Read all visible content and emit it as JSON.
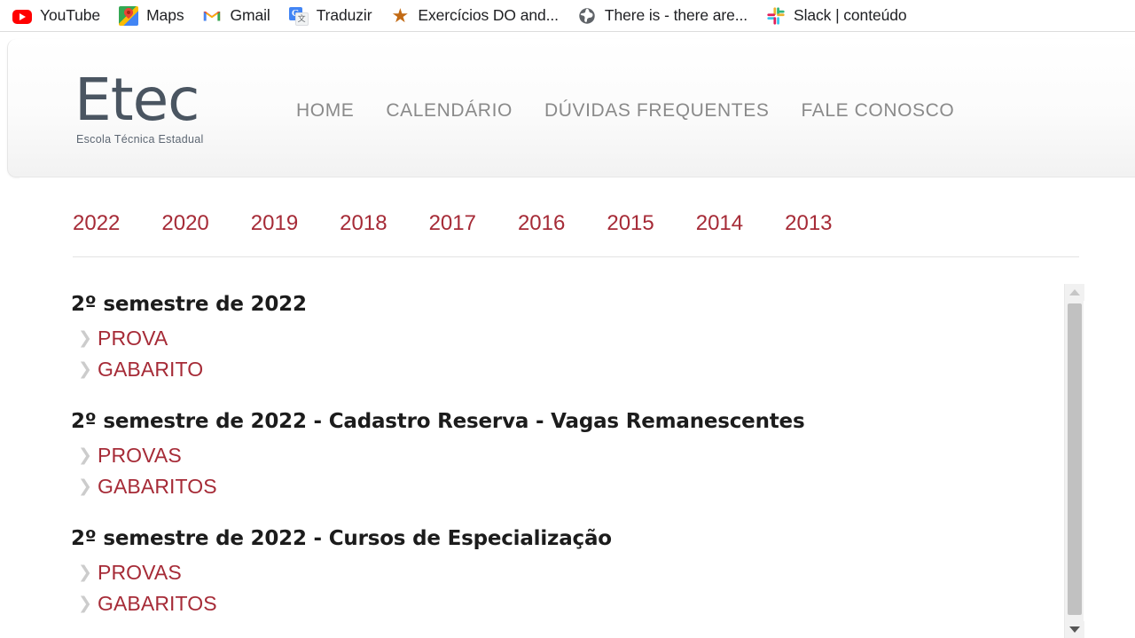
{
  "browser": {
    "bookmarks": [
      {
        "label": "YouTube",
        "icon": "youtube-icon"
      },
      {
        "label": "Maps",
        "icon": "google-maps-icon"
      },
      {
        "label": "Gmail",
        "icon": "gmail-icon"
      },
      {
        "label": "Traduzir",
        "icon": "google-translate-icon"
      },
      {
        "label": "Exercícios DO and...",
        "icon": "star-icon"
      },
      {
        "label": "There is - there are...",
        "icon": "globe-icon"
      },
      {
        "label": "Slack | conteúdo",
        "icon": "slack-icon"
      }
    ]
  },
  "site_header": {
    "logo": {
      "wordmark": "Etec",
      "tagline": "Escola Técnica Estadual"
    },
    "nav": [
      {
        "label": "HOME"
      },
      {
        "label": "CALENDÁRIO"
      },
      {
        "label": "DÚVIDAS FREQUENTES"
      },
      {
        "label": "FALE CONOSCO"
      }
    ]
  },
  "year_tabs": [
    {
      "label": "2022",
      "selected": true
    },
    {
      "label": "2020",
      "selected": false
    },
    {
      "label": "2019",
      "selected": false
    },
    {
      "label": "2018",
      "selected": false
    },
    {
      "label": "2017",
      "selected": false
    },
    {
      "label": "2016",
      "selected": false
    },
    {
      "label": "2015",
      "selected": false
    },
    {
      "label": "2014",
      "selected": false
    },
    {
      "label": "2013",
      "selected": false
    }
  ],
  "content": {
    "sections": [
      {
        "title": "2º semestre de 2022",
        "links": [
          {
            "label": "PROVA"
          },
          {
            "label": "GABARITO"
          }
        ]
      },
      {
        "title": "2º semestre de 2022 - Cadastro Reserva - Vagas Remanescentes",
        "links": [
          {
            "label": "PROVAS"
          },
          {
            "label": "GABARITOS"
          }
        ]
      },
      {
        "title": "2º semestre de 2022 - Cursos de Especialização",
        "links": [
          {
            "label": "PROVAS"
          },
          {
            "label": "GABARITOS"
          }
        ]
      }
    ]
  },
  "scrollbar": {
    "up_arrow": "▲",
    "down_arrow": "▼"
  },
  "glyphs": {
    "chevron": "❯",
    "star": "★",
    "globe": "🌐"
  },
  "colors": {
    "link_red": "#a62b37",
    "logo_slate": "#4a5561",
    "nav_gray": "#8a8a8a",
    "heading_black": "#1c1c1c",
    "chevron_gray": "#cccccc",
    "scroll_thumb": "#c1c1c1"
  }
}
